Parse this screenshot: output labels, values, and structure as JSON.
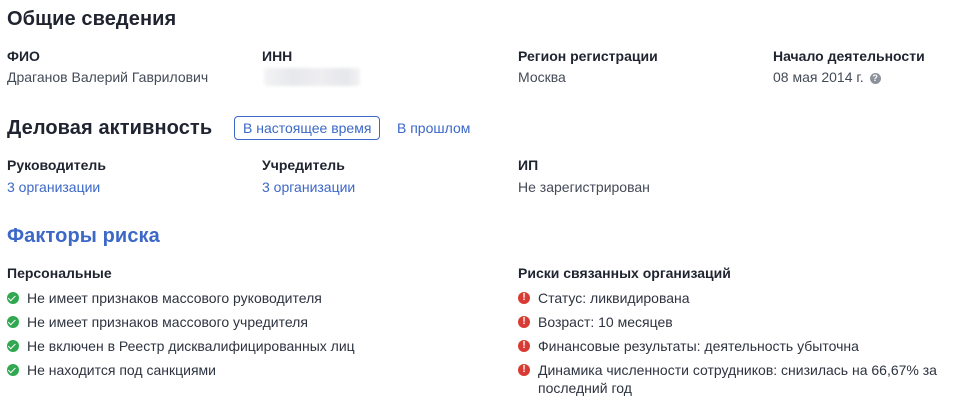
{
  "general": {
    "title": "Общие сведения",
    "fio_label": "ФИО",
    "fio_value": "Драганов Валерий Гаврилович",
    "inn_label": "ИНН",
    "region_label": "Регион регистрации",
    "region_value": "Москва",
    "start_label": "Начало деятельности",
    "start_value": "08 мая 2014 г.",
    "help_glyph": "?"
  },
  "business": {
    "title": "Деловая активность",
    "tab_now": "В настоящее время",
    "tab_past": "В прошлом",
    "director_label": "Руководитель",
    "director_value": "3 организации",
    "founder_label": "Учредитель",
    "founder_value": "3 организации",
    "ip_label": "ИП",
    "ip_value": "Не зарегистрирован"
  },
  "risks": {
    "title": "Факторы риска",
    "personal_title": "Персональные",
    "personal_items": [
      "Не имеет признаков массового руководителя",
      "Не имеет признаков массового учредителя",
      "Не включен в Реестр дисквалифицированных лиц",
      "Не находится под санкциями"
    ],
    "related_title": "Риски связанных организаций",
    "related_items": [
      "Статус: ликвидирована",
      "Возраст: 10 месяцев",
      "Финансовые результаты: деятельность убыточна",
      "Динамика численности сотрудников: снизилась на 66,67% за последний год"
    ],
    "warn_glyph": "!"
  },
  "colors": {
    "accent": "#3c68c7",
    "ok": "#2fa84f",
    "warn": "#d93a32",
    "text": "#1f2430"
  },
  "icons": {
    "ok": "check-circle-icon",
    "warn": "exclamation-circle-icon",
    "help": "question-circle-icon"
  }
}
